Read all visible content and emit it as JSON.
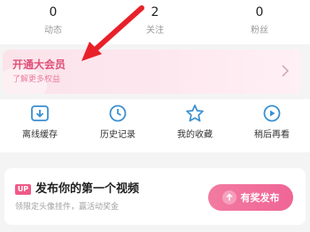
{
  "stats": [
    {
      "value": "0",
      "label": "动态"
    },
    {
      "value": "2",
      "label": "关注"
    },
    {
      "value": "0",
      "label": "粉丝"
    }
  ],
  "vip": {
    "title": "开通大会员",
    "subtitle": "了解更多权益"
  },
  "shortcuts": [
    {
      "label": "离线缓存",
      "icon": "offline-cache-icon"
    },
    {
      "label": "历史记录",
      "icon": "history-clock-icon"
    },
    {
      "label": "我的收藏",
      "icon": "star-icon"
    },
    {
      "label": "稍后再看",
      "icon": "watch-later-icon"
    }
  ],
  "upload": {
    "badge": "UP",
    "title": "发布你的第一个视频",
    "subtitle": "领限定头像挂件，赢活动奖金",
    "button_label": "有奖发布"
  },
  "colors": {
    "accent": "#f06595",
    "icon_blue": "#3a8fd0",
    "annotation_red": "#e8202a"
  }
}
